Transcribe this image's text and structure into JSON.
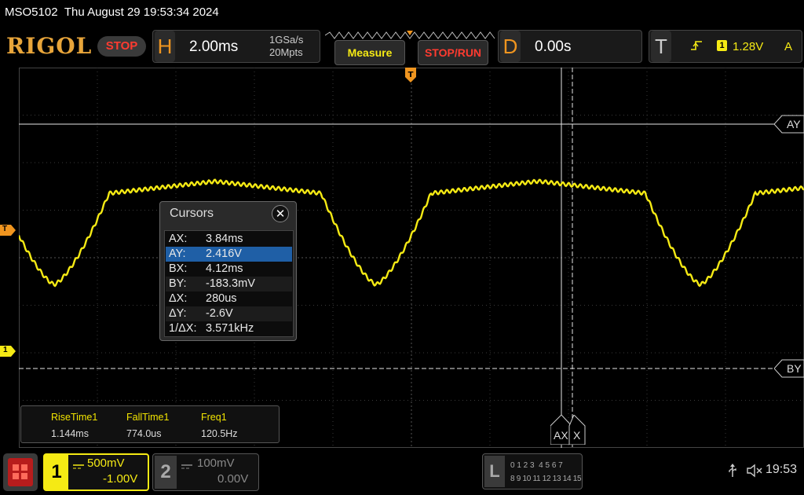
{
  "titlebar": {
    "model": "MSO5102",
    "datetime": "Thu August 29 19:53:34 2024"
  },
  "toolbar": {
    "logo": "RIGOL",
    "run_state": "STOP",
    "horizontal": {
      "letter": "H",
      "timebase": "2.00ms",
      "sample_rate": "1GSa/s",
      "memory_depth": "20Mpts"
    },
    "measure_label": "Measure",
    "stoprun_label": "STOP/RUN",
    "delay": {
      "letter": "D",
      "value": "0.00s"
    },
    "trigger": {
      "letter": "T",
      "source": "1",
      "level": "1.28V",
      "mode": "A"
    }
  },
  "screen": {
    "trigger_marker": "T",
    "channel1_marker": "1",
    "cursor_labels": {
      "ay": "AY",
      "by": "BY",
      "ax": "AX",
      "bx": "X"
    }
  },
  "cursors_dialog": {
    "title": "Cursors",
    "close": "✕",
    "rows": [
      {
        "key": "AX:",
        "value": "3.84ms"
      },
      {
        "key": "AY:",
        "value": "2.416V"
      },
      {
        "key": "BX:",
        "value": "4.12ms"
      },
      {
        "key": "BY:",
        "value": "-183.3mV"
      },
      {
        "key": "ΔX:",
        "value": "280us"
      },
      {
        "key": "ΔY:",
        "value": "-2.6V"
      },
      {
        "key": "1/ΔX:",
        "value": "3.571kHz"
      }
    ],
    "selected_row": 1
  },
  "measurements": [
    {
      "name": "RiseTime1",
      "value": "1.144ms"
    },
    {
      "name": "FallTime1",
      "value": "774.0us"
    },
    {
      "name": "Freq1",
      "value": "120.5Hz"
    }
  ],
  "bottom": {
    "ch1": {
      "number": "1",
      "scale": "500mV",
      "offset": "-1.00V"
    },
    "ch2": {
      "number": "2",
      "scale": "100mV",
      "offset": "0.00V"
    },
    "logic": {
      "letter": "L",
      "row1": "0 1 2 3  4 5 6 7",
      "row2": "8 9 10 11 12 13 14 15"
    },
    "clock": "19:53"
  },
  "colors": {
    "ch1": "#f5ea14",
    "accent": "#f0951f",
    "stop": "#ff3b30",
    "selected": "#1f5fa6"
  }
}
